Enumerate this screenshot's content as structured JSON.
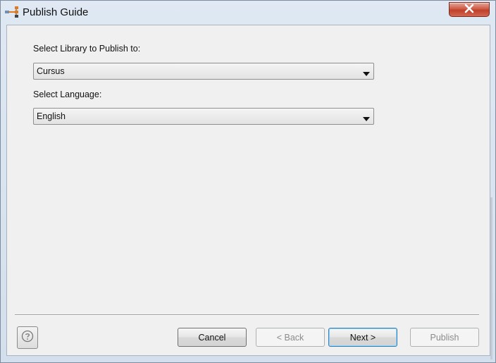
{
  "window": {
    "title": "Publish Guide",
    "app_icon": "workflow-icon",
    "close_icon": "close-icon"
  },
  "form": {
    "library_label": "Select Library to Publish to:",
    "library_value": "Cursus",
    "language_label": "Select Language:",
    "language_value": "English"
  },
  "footer": {
    "help_icon": "help-icon",
    "cancel_label": "Cancel",
    "back_label": "< Back",
    "next_label": "Next >",
    "publish_label": "Publish"
  },
  "colors": {
    "close_button": "#c7432f",
    "dialog_background": "#f0f0f0",
    "default_button_border": "#3c7fb1"
  }
}
